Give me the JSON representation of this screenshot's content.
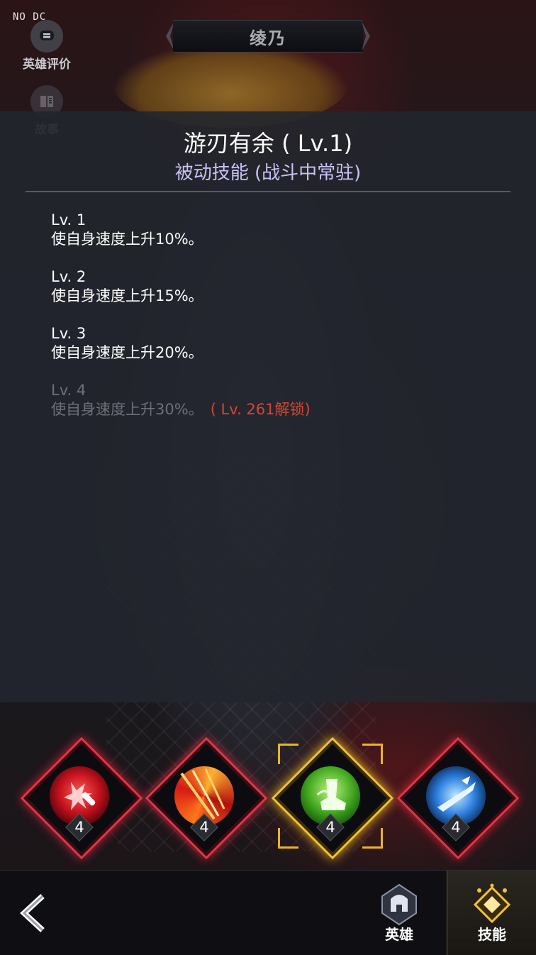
{
  "debug_tag": "NO DC",
  "side_buttons": {
    "review_label": "英雄评价",
    "story_label": "故事"
  },
  "hero_name": "绫乃",
  "skill_panel": {
    "title": "游刃有余 ( Lv.1)",
    "type": "被动技能 (战斗中常驻)",
    "levels": [
      {
        "name": "Lv. 1",
        "desc": "使自身速度上升10%。",
        "locked": false,
        "unlock": ""
      },
      {
        "name": "Lv. 2",
        "desc": "使自身速度上升15%。",
        "locked": false,
        "unlock": ""
      },
      {
        "name": "Lv. 3",
        "desc": "使自身速度上升20%。",
        "locked": false,
        "unlock": ""
      },
      {
        "name": "Lv. 4",
        "desc": "使自身速度上升30%。",
        "locked": true,
        "unlock": "( Lv. 261解锁)"
      }
    ]
  },
  "skills": [
    {
      "icon": "dagger-burst-icon",
      "level": "4",
      "selected": false
    },
    {
      "icon": "flame-slash-icon",
      "level": "4",
      "selected": false
    },
    {
      "icon": "green-boot-icon",
      "level": "4",
      "selected": true
    },
    {
      "icon": "ice-blade-icon",
      "level": "4",
      "selected": false
    }
  ],
  "bottom_nav": {
    "hero_label": "英雄",
    "skill_label": "技能"
  },
  "colors": {
    "accent_gold": "#f2c232",
    "skill_red": "#e0364a",
    "subtitle_purple": "#c9c2f5",
    "unlock_red": "#d8452f"
  }
}
